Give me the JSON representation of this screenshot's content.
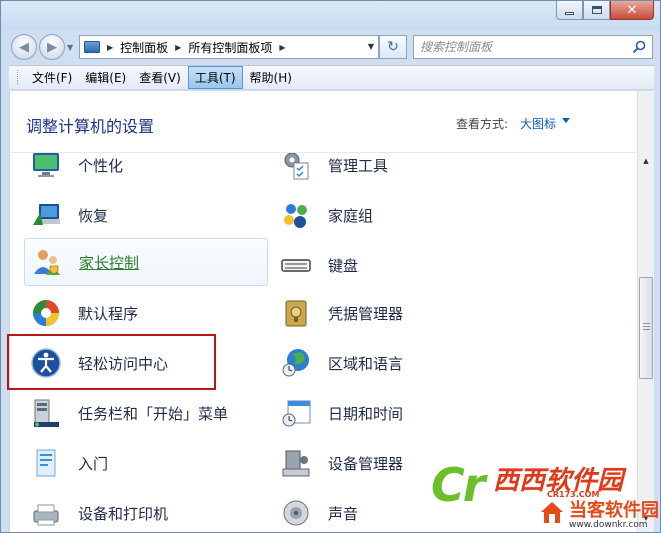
{
  "window": {
    "buttons": {
      "close": "✕"
    }
  },
  "address_bar": {
    "crumbs": [
      "控制面板",
      "所有控制面板项"
    ],
    "refresh_glyph": "↻"
  },
  "search": {
    "placeholder": "搜索控制面板"
  },
  "menubar": {
    "items": [
      {
        "label": "文件(F)",
        "active": false
      },
      {
        "label": "编辑(E)",
        "active": false
      },
      {
        "label": "查看(V)",
        "active": false
      },
      {
        "label": "工具(T)",
        "active": true
      },
      {
        "label": "帮助(H)",
        "active": false
      }
    ]
  },
  "content": {
    "title": "调整计算机的设置",
    "view_by_label": "查看方式:",
    "view_by_value": "大图标"
  },
  "items": {
    "left": [
      {
        "label": "个性化",
        "icon": "personalization-icon"
      },
      {
        "label": "恢复",
        "icon": "recovery-icon"
      },
      {
        "label": "家长控制",
        "icon": "parental-controls-icon",
        "hovered": true
      },
      {
        "label": "默认程序",
        "icon": "default-programs-icon"
      },
      {
        "label": "轻松访问中心",
        "icon": "ease-of-access-icon",
        "highlighted": true
      },
      {
        "label": "任务栏和「开始」菜单",
        "icon": "taskbar-icon"
      },
      {
        "label": "入门",
        "icon": "getting-started-icon"
      },
      {
        "label": "设备和打印机",
        "icon": "devices-printers-icon"
      }
    ],
    "right": [
      {
        "label": "管理工具",
        "icon": "admin-tools-icon"
      },
      {
        "label": "家庭组",
        "icon": "homegroup-icon"
      },
      {
        "label": "键盘",
        "icon": "keyboard-icon"
      },
      {
        "label": "凭据管理器",
        "icon": "credential-manager-icon"
      },
      {
        "label": "区域和语言",
        "icon": "region-language-icon"
      },
      {
        "label": "日期和时间",
        "icon": "date-time-icon"
      },
      {
        "label": "设备管理器",
        "icon": "device-manager-icon"
      },
      {
        "label": "声音",
        "icon": "sound-icon"
      }
    ]
  },
  "watermark": {
    "cr": "Cr",
    "name": "西西软件园",
    "sub": "CR173.COM",
    "name2": "当客软件园",
    "url": "www.downkr.com"
  },
  "colors": {
    "title_blue": "#1e3287",
    "link_blue": "#0a5fae",
    "hover_green": "#2a7d2a",
    "highlight_red": "#b11a1a"
  }
}
